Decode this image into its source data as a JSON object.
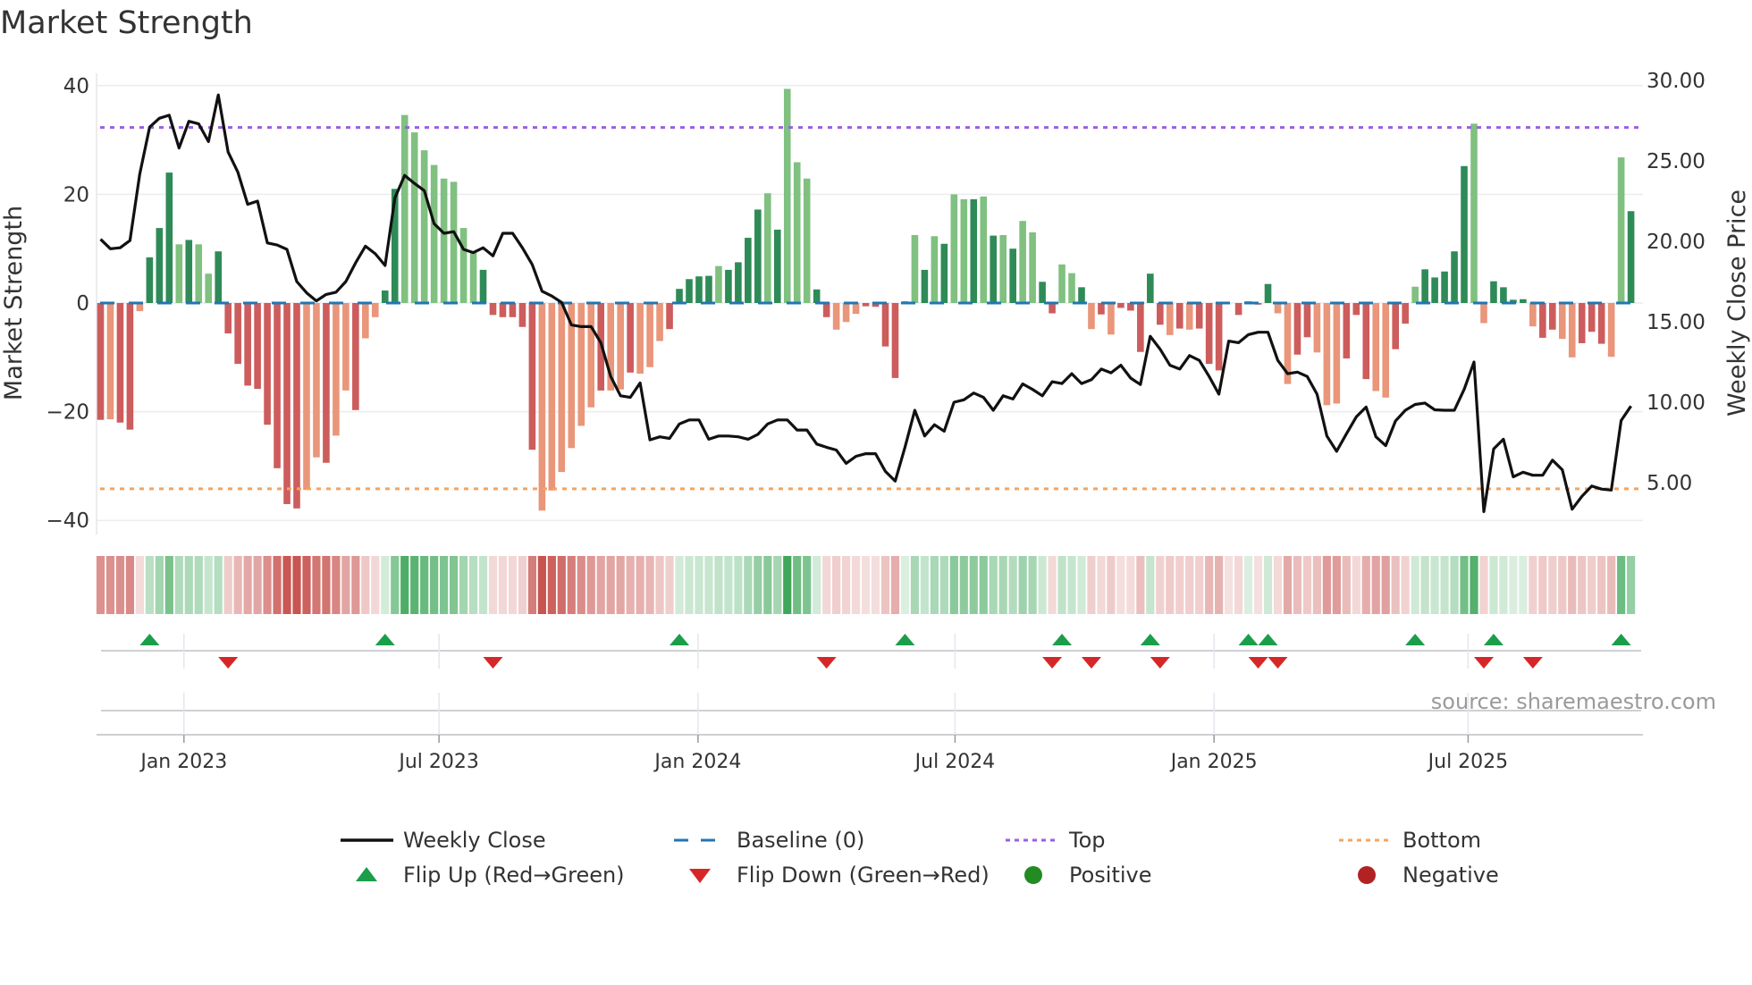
{
  "chart_data": {
    "type": "bar",
    "title": "Market Strength",
    "ylabel": "Market Strength",
    "y2label": "Weekly Close Price",
    "ylim": [
      -40,
      40
    ],
    "y2lim": [
      2.5,
      30
    ],
    "yticks": [
      "40",
      "20",
      "0",
      "−20",
      "−40"
    ],
    "ytick_values": [
      40,
      20,
      0,
      -20,
      -40
    ],
    "y2ticks": [
      "30.00",
      "25.00",
      "20.00",
      "15.00",
      "10.00",
      "5.00"
    ],
    "y2tick_values": [
      30,
      25,
      20,
      15,
      10,
      5
    ],
    "xticks": [
      "Jan 2023",
      "Jul 2023",
      "Jan 2024",
      "Jul 2024",
      "Jan 2025",
      "Jul 2025"
    ],
    "xtick_week_index": [
      8.5,
      34.5,
      60.9,
      87.1,
      113.5,
      139.4
    ],
    "top_level": 32.3,
    "bottom_level": -34.2,
    "baseline": 0,
    "strength": [
      -21.5,
      -21.4,
      -22,
      -23.3,
      -1.5,
      8.4,
      13.8,
      24,
      10.8,
      11.6,
      10.8,
      5.4,
      9.5,
      -5.6,
      -11.2,
      -15.2,
      -15.8,
      -22.4,
      -30.4,
      -37,
      -37.8,
      -34.4,
      -28.4,
      -29.4,
      -24.4,
      -16.1,
      -19.7,
      -6.5,
      -2.6,
      2.3,
      21,
      34.6,
      31.4,
      28.1,
      25.4,
      22.9,
      22.3,
      13.8,
      9.2,
      6.1,
      -2.2,
      -2.6,
      -2.6,
      -4.4,
      -27,
      -38.2,
      -34.5,
      -31.1,
      -26.7,
      -22.6,
      -19.2,
      -16.1,
      -16.1,
      -15.9,
      -12.8,
      -13,
      -11.8,
      -7,
      -4.8,
      2.6,
      4.4,
      4.9,
      5,
      6.8,
      6.1,
      7.5,
      12,
      17.2,
      20.2,
      13.5,
      39.4,
      25.9,
      22.9,
      2.5,
      -2.6,
      -4.9,
      -3.5,
      -2,
      -0.6,
      -0.7,
      -8,
      -13.8,
      0.3,
      12.5,
      6.1,
      12.3,
      10.9,
      20,
      19.1,
      19.1,
      19.6,
      12.4,
      12.5,
      10,
      15.1,
      13,
      3.9,
      -1.9,
      7.1,
      5.5,
      2.9,
      -4.8,
      -2.1,
      -5.8,
      -0.9,
      -1.4,
      -9,
      5.4,
      -4,
      -5.9,
      -4.7,
      -4.9,
      -4.7,
      -11.2,
      -12.4,
      0,
      -2.2,
      0.3,
      -0.3,
      3.5,
      -1.9,
      -14.9,
      -9.5,
      -6.3,
      -9.1,
      -18.8,
      -18.5,
      -10.2,
      -2.2,
      -14,
      -16.2,
      -17.4,
      -8.5,
      -3.8,
      3,
      6.2,
      4.7,
      5.8,
      9.5,
      25.2,
      33,
      -3.7,
      4,
      2.9,
      0.6,
      0.7,
      -4.3,
      -6.4,
      -4.9,
      -6.6,
      -10,
      -7.4,
      -5.3,
      -7.5,
      -9.9,
      26.8,
      16.9
    ],
    "strength_shade": "dlddldddldlldddddddddlldlldllddllllllllddddddlllllldlldllldddddlddddldlllddllldddddldldlldldldllddlldldlddddd ldlddddddddllddllldddllddldddddllddddlddlldddllddldd",
    "weekly_close": [
      20.13,
      19.54,
      19.6,
      20.05,
      24.2,
      27.1,
      27.65,
      27.84,
      25.8,
      27.46,
      27.3,
      26.2,
      29.1,
      25.55,
      24.3,
      22.3,
      22.5,
      19.9,
      19.77,
      19.5,
      17.5,
      16.8,
      16.3,
      16.7,
      16.84,
      17.5,
      18.66,
      19.7,
      19.23,
      18.5,
      22.7,
      24.1,
      23.6,
      23.15,
      21.1,
      20.5,
      20.6,
      19.5,
      19.3,
      19.6,
      19.1,
      20.5,
      20.5,
      19.6,
      18.56,
      16.9,
      16.6,
      16.2,
      14.8,
      14.7,
      14.7,
      13.7,
      11.6,
      10.4,
      10.3,
      11.2,
      7.66,
      7.85,
      7.75,
      8.65,
      8.9,
      8.9,
      7.7,
      7.9,
      7.9,
      7.85,
      7.7,
      8.0,
      8.65,
      8.9,
      8.9,
      8.27,
      8.27,
      7.4,
      7.2,
      7.03,
      6.2,
      6.64,
      6.8,
      6.8,
      5.7,
      5.1,
      7.2,
      9.5,
      7.9,
      8.6,
      8.2,
      10.0,
      10.15,
      10.57,
      10.3,
      9.5,
      10.4,
      10.2,
      11.14,
      10.8,
      10.4,
      11.27,
      11.16,
      11.77,
      11.16,
      11.4,
      12.06,
      11.83,
      12.3,
      11.5,
      11.1,
      14.1,
      13.3,
      12.3,
      12.06,
      12.9,
      12.6,
      11.6,
      10.5,
      13.8,
      13.7,
      14.2,
      14.35,
      14.35,
      12.6,
      11.77,
      11.87,
      11.6,
      10.5,
      7.9,
      6.95,
      8.04,
      9.09,
      9.7,
      7.85,
      7.3,
      8.84,
      9.5,
      9.86,
      9.95,
      9.53,
      9.5,
      9.5,
      10.8,
      12.5,
      3.2,
      7.1,
      7.7,
      5.36,
      5.65,
      5.46,
      5.46,
      6.4,
      5.8,
      3.35,
      4.15,
      4.79,
      4.6,
      4.54,
      8.86,
      9.76
    ],
    "flip_up_weeks": [
      6,
      30,
      60,
      83,
      99,
      108,
      118,
      120,
      135,
      143,
      156
    ],
    "flip_down_weeks": [
      14,
      41,
      75,
      98,
      102,
      109,
      119,
      121,
      142,
      147
    ],
    "legend": {
      "placement": "bottom",
      "items": [
        "Weekly Close",
        "Baseline (0)",
        "Top",
        "Bottom",
        "Flip Up (Red→Green)",
        "Flip Down (Green→Red)",
        "Positive",
        "Negative"
      ]
    },
    "colors": {
      "pos_dark": "#2e8b57",
      "pos_light": "#80c080",
      "neg_dark": "#cd5c5c",
      "neg_light": "#e9967a",
      "line": "#111111",
      "baseline": "#1f77b4",
      "top": "#9b5de5",
      "bottom": "#f4a460",
      "flip_up": "#1a9e4a",
      "flip_down": "#d62728",
      "positive": "#228b22",
      "negative": "#b22222"
    }
  },
  "source": "source: sharemaestro.com"
}
